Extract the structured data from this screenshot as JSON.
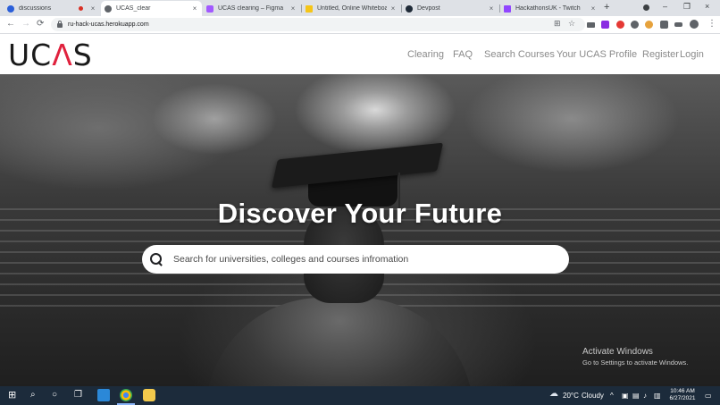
{
  "browser": {
    "tabs": [
      {
        "title": "discussions",
        "favicon_color": "#2b5fd9",
        "recording": true
      },
      {
        "title": "UCAS_clear",
        "favicon_color": "#5f6368",
        "active": true
      },
      {
        "title": "UCAS clearing – Figma",
        "favicon_color": "#a259ff"
      },
      {
        "title": "Untitled, Online Whiteboar",
        "favicon_color": "#f5c518"
      },
      {
        "title": "Devpost",
        "favicon_color": "#1f2a37"
      },
      {
        "title": "HackathonsUK - Twitch",
        "favicon_color": "#9146ff"
      }
    ],
    "close_glyph": "×",
    "new_tab_glyph": "+",
    "window_controls": [
      "–",
      "❐",
      "×"
    ],
    "nav": {
      "back": "←",
      "forward": "→",
      "reload": "⟳"
    },
    "url": "ru-hack-ucas.herokuapp.com",
    "menu_glyph": "⋮"
  },
  "site": {
    "logo_pre": "UC",
    "logo_accent": "Λ",
    "logo_post": "S",
    "logo_color": "#1a1a1a",
    "accent_color": "#e0213d",
    "nav": [
      {
        "label": "Clearing"
      },
      {
        "label": "FAQ"
      },
      {
        "label": "Search Courses"
      },
      {
        "label": "Your UCAS Profile"
      },
      {
        "label": "Register"
      },
      {
        "label": "Login"
      }
    ]
  },
  "hero": {
    "title": "Discover Your Future",
    "search_placeholder": "Search for universities, colleges and courses infromation"
  },
  "watermark": {
    "line1": "Activate Windows",
    "line2": "Go to Settings to activate Windows."
  },
  "taskbar": {
    "weather_temp": "20°C",
    "weather_text": "Cloudy",
    "time": "10:46 AM",
    "date": "6/27/2021",
    "accent_color": "#1c2b3b"
  }
}
